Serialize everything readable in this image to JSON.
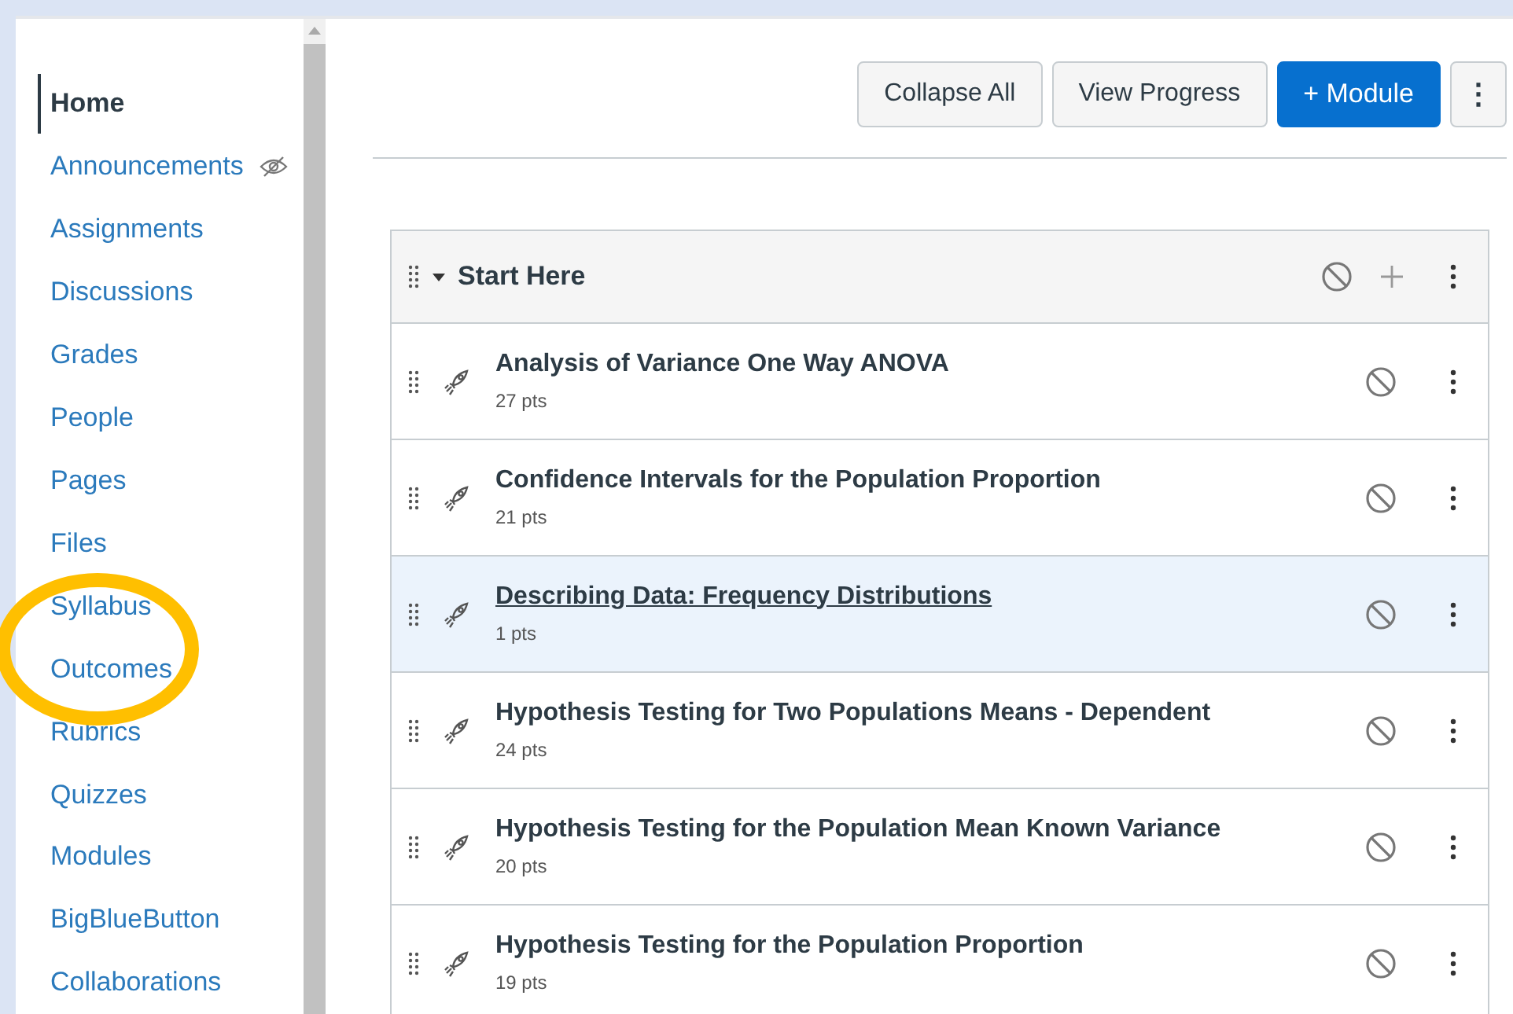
{
  "sidebar": {
    "items": [
      {
        "label": "Home",
        "selected": true,
        "hidden": false
      },
      {
        "label": "Announcements",
        "selected": false,
        "hidden": true
      },
      {
        "label": "Assignments",
        "selected": false,
        "hidden": false
      },
      {
        "label": "Discussions",
        "selected": false,
        "hidden": false
      },
      {
        "label": "Grades",
        "selected": false,
        "hidden": false
      },
      {
        "label": "People",
        "selected": false,
        "hidden": false
      },
      {
        "label": "Pages",
        "selected": false,
        "hidden": false
      },
      {
        "label": "Files",
        "selected": false,
        "hidden": false
      },
      {
        "label": "Syllabus",
        "selected": false,
        "hidden": false
      },
      {
        "label": "Outcomes",
        "selected": false,
        "hidden": false
      },
      {
        "label": "Rubrics",
        "selected": false,
        "hidden": false
      },
      {
        "label": "Quizzes",
        "selected": false,
        "hidden": false
      },
      {
        "label": "Modules",
        "selected": false,
        "hidden": false
      },
      {
        "label": "BigBlueButton",
        "selected": false,
        "hidden": false
      },
      {
        "label": "Collaborations",
        "selected": false,
        "hidden": false
      }
    ]
  },
  "toolbar": {
    "buttons": [
      {
        "label": "Collapse All",
        "kind": "default"
      },
      {
        "label": "View Progress",
        "kind": "default"
      },
      {
        "label": "+ Module",
        "kind": "primary"
      },
      {
        "label": "⋮",
        "kind": "menu"
      }
    ]
  },
  "module": {
    "title": "Start Here",
    "expanded": true,
    "published": false,
    "items": [
      {
        "title": "Analysis of Variance One Way ANOVA",
        "points": "27 pts",
        "selected": false,
        "published": false
      },
      {
        "title": "Confidence Intervals for the Population Proportion",
        "points": "21 pts",
        "selected": false,
        "published": false
      },
      {
        "title": "Describing Data: Frequency Distributions",
        "points": "1 pts",
        "selected": true,
        "published": false
      },
      {
        "title": "Hypothesis Testing for Two Populations Means - Dependent",
        "points": "24 pts",
        "selected": false,
        "published": false
      },
      {
        "title": "Hypothesis Testing for the Population Mean Known Variance",
        "points": "20 pts",
        "selected": false,
        "published": false
      },
      {
        "title": "Hypothesis Testing for the Population Proportion",
        "points": "19 pts",
        "selected": false,
        "published": false
      }
    ]
  }
}
